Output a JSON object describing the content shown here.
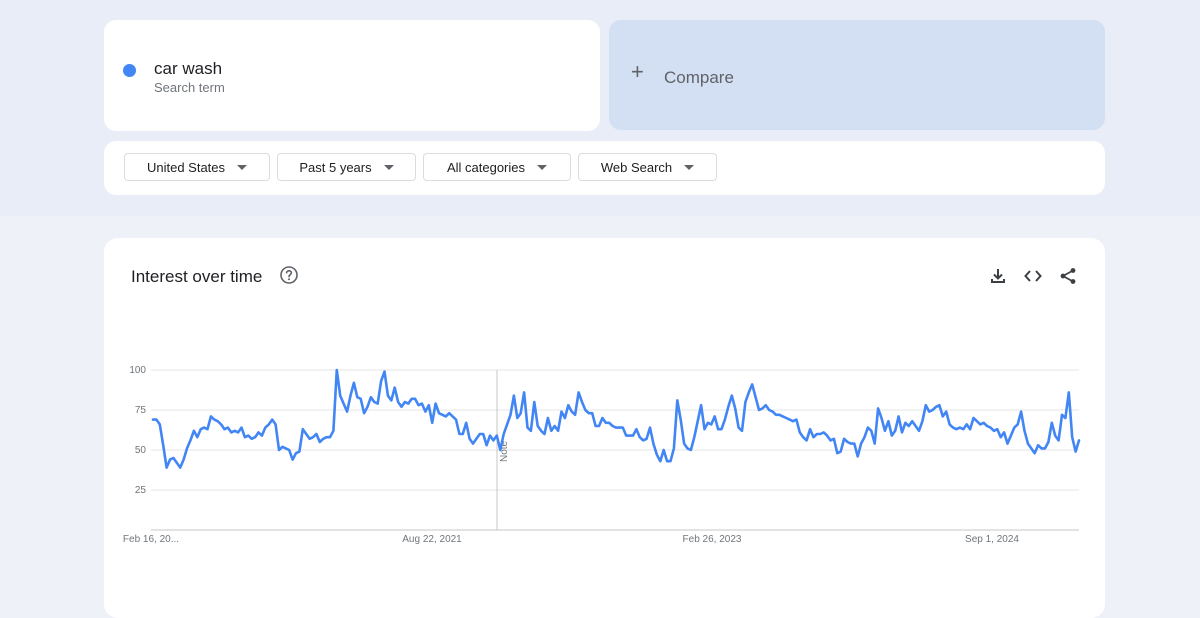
{
  "search": {
    "term": "car wash",
    "term_type": "Search term",
    "term_color": "#4285f4",
    "compare_label": "Compare",
    "compare_icon": "plus-icon"
  },
  "filters": {
    "region": "United States",
    "time_range": "Past 5 years",
    "category": "All categories",
    "search_type": "Web Search"
  },
  "panel": {
    "title": "Interest over time",
    "help_icon": "help-circle-icon",
    "actions": [
      "download-icon",
      "embed-code-icon",
      "share-icon"
    ]
  },
  "chart_data": {
    "type": "line",
    "ylim": [
      0,
      100
    ],
    "y_ticks": [
      "100",
      "75",
      "50",
      "25"
    ],
    "x_tick_labels": [
      "Feb 16, 20...",
      "Aug 22, 2021",
      "Feb 26, 2023",
      "Sep 1, 2024"
    ],
    "grid": true,
    "annotation": "Note",
    "series": [
      {
        "color": "#4285f4",
        "values": [
          69,
          69,
          66,
          53,
          39,
          44,
          45,
          42,
          39,
          44,
          51,
          56,
          62,
          58,
          63,
          64,
          63,
          71,
          69,
          68,
          66,
          63,
          64,
          61,
          62,
          61,
          64,
          58,
          59,
          57,
          58,
          61,
          59,
          64,
          66,
          69,
          66,
          50,
          52,
          51,
          50,
          44,
          48,
          49,
          63,
          60,
          57,
          58,
          60,
          55,
          57,
          58,
          58,
          62,
          100,
          84,
          79,
          74,
          84,
          92,
          83,
          82,
          73,
          77,
          83,
          80,
          79,
          93,
          99,
          84,
          81,
          89,
          80,
          77,
          80,
          79,
          82,
          82,
          78,
          79,
          74,
          78,
          67,
          79,
          73,
          72,
          71,
          73,
          71,
          69,
          60,
          60,
          67,
          57,
          54,
          57,
          60,
          60,
          53,
          59,
          56,
          59,
          50,
          60,
          66,
          72,
          84,
          70,
          73,
          86,
          64,
          62,
          80,
          65,
          62,
          60,
          70,
          62,
          65,
          62,
          74,
          70,
          78,
          74,
          72,
          86,
          80,
          75,
          73,
          73,
          65,
          65,
          70,
          67,
          67,
          65,
          64,
          64,
          64,
          59,
          59,
          59,
          63,
          58,
          56,
          57,
          64,
          54,
          47,
          43,
          50,
          43,
          43,
          51,
          81,
          69,
          54,
          51,
          50,
          58,
          68,
          78,
          63,
          67,
          66,
          71,
          63,
          63,
          69,
          77,
          84,
          76,
          64,
          62,
          80,
          86,
          91,
          83,
          75,
          76,
          78,
          75,
          74,
          72,
          72,
          71,
          70,
          69,
          68,
          69,
          61,
          58,
          56,
          63,
          58,
          60,
          60,
          61,
          59,
          56,
          57,
          48,
          49,
          57,
          55,
          54,
          54,
          46,
          54,
          58,
          64,
          62,
          54,
          76,
          70,
          62,
          68,
          59,
          62,
          71,
          61,
          67,
          65,
          68,
          65,
          62,
          68,
          78,
          74,
          75,
          77,
          78,
          71,
          74,
          66,
          64,
          63,
          64,
          63,
          66,
          63,
          70,
          68,
          66,
          67,
          65,
          64,
          62,
          63,
          58,
          61,
          54,
          59,
          64,
          66,
          74,
          62,
          54,
          51,
          48,
          53,
          51,
          51,
          55,
          67,
          59,
          56,
          72,
          70,
          86,
          58,
          49,
          56
        ]
      }
    ]
  }
}
